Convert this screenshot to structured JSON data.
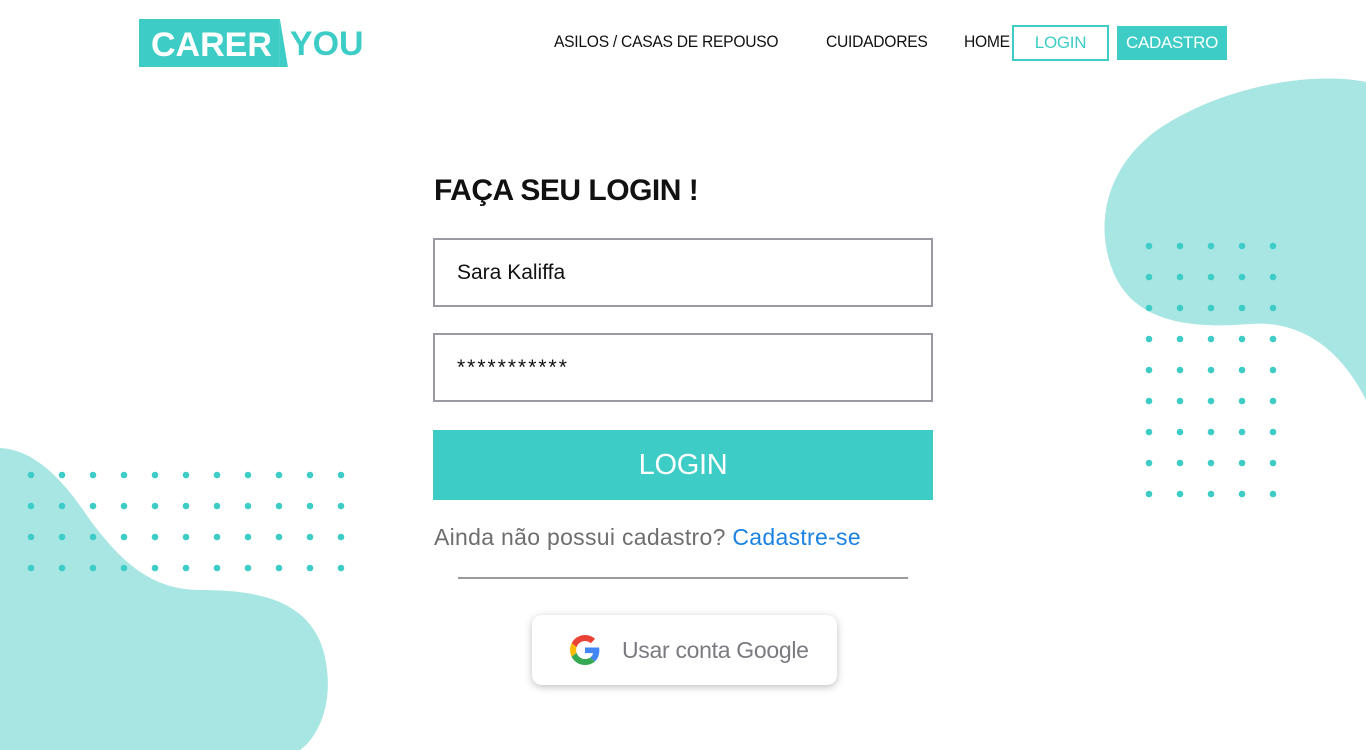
{
  "brand": {
    "logo_part1": "CARER",
    "logo_part2": "YOU",
    "accent_color": "#3ecdc6",
    "blob_color": "#a8e6e3",
    "link_color": "#1a82e2"
  },
  "nav": {
    "items": [
      {
        "label": "ASILOS / CASAS DE REPOUSO"
      },
      {
        "label": "CUIDADORES"
      },
      {
        "label": "HOME"
      }
    ],
    "login_label": "LOGIN",
    "signup_label": "CADASTRO"
  },
  "form": {
    "title": "FAÇA SEU LOGIN !",
    "username_value": "Sara Kaliffa",
    "password_value": "***********",
    "submit_label": "LOGIN",
    "no_account_text": "Ainda não possui cadastro?",
    "signup_link": "Cadastre-se",
    "google_label": "Usar conta Google",
    "google_icon": "google-icon"
  }
}
